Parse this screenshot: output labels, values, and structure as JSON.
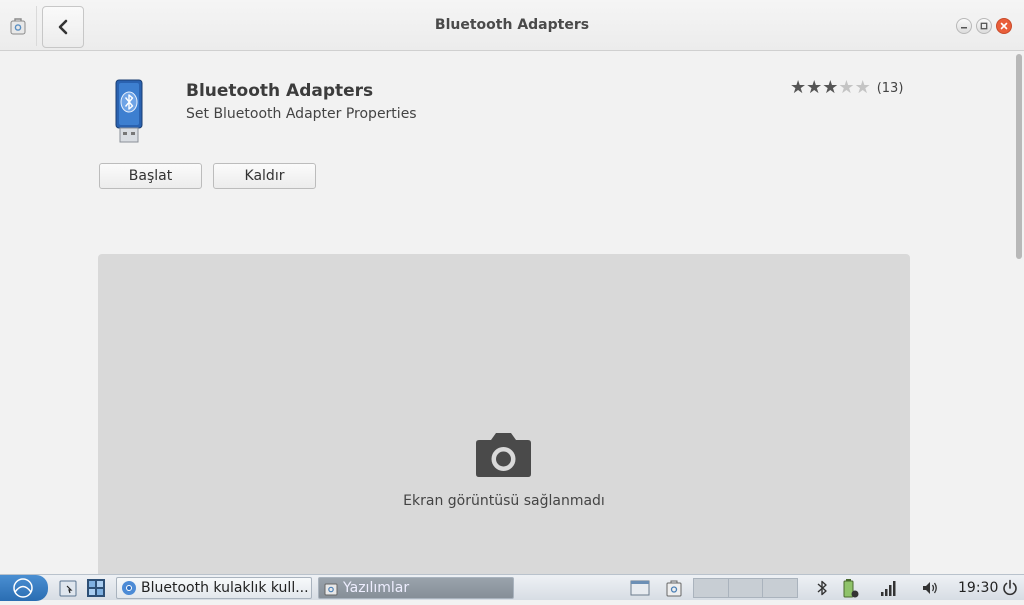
{
  "window": {
    "title": "Bluetooth Adapters"
  },
  "app": {
    "name": "Bluetooth Adapters",
    "description": "Set Bluetooth Adapter Properties",
    "rating": {
      "stars_filled": 3,
      "stars_total": 5,
      "count_label": "(13)"
    },
    "launch_label": "Başlat",
    "remove_label": "Kaldır"
  },
  "screenshot": {
    "placeholder_text": "Ekran görüntüsü sağlanmadı"
  },
  "taskbar": {
    "tasks": [
      {
        "label": "Bluetooth kulaklık kull..."
      },
      {
        "label": "Yazılımlar"
      }
    ],
    "clock": "19:30"
  },
  "colors": {
    "close_button": "#e95e3a",
    "accent_start": "#2a6db2"
  }
}
